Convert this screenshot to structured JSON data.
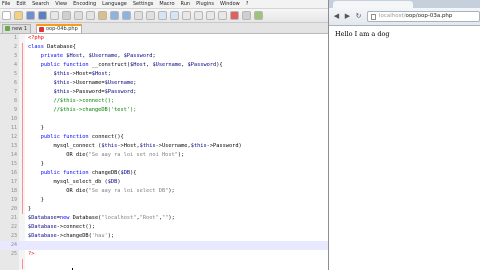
{
  "editor": {
    "menu": [
      "File",
      "Edit",
      "Search",
      "View",
      "Encoding",
      "Language",
      "Settings",
      "Macro",
      "Run",
      "Plugins",
      "Window",
      "?"
    ],
    "tabs": [
      "new 1",
      "oop-04b.php"
    ],
    "lines": [
      {
        "n": "1",
        "t": "<?php"
      },
      {
        "n": "2",
        "t": "class Database{"
      },
      {
        "n": "3",
        "t": "    private $Host, $Username, $Password;"
      },
      {
        "n": "4",
        "t": "    public function __construct($Host, $Username, $Password){"
      },
      {
        "n": "5",
        "t": "        $this->Host=$Host;"
      },
      {
        "n": "6",
        "t": "        $this->Username=$Username;"
      },
      {
        "n": "7",
        "t": "        $this->Password=$Password;"
      },
      {
        "n": "8",
        "t": "        //$this->connect();"
      },
      {
        "n": "9",
        "t": "        //$this->changeDB('test');"
      },
      {
        "n": "10",
        "t": ""
      },
      {
        "n": "11",
        "t": "    }"
      },
      {
        "n": "12",
        "t": "    public function connect(){"
      },
      {
        "n": "13",
        "t": "        mysql_connect ($this->Host,$this->Username,$this->Password)"
      },
      {
        "n": "14",
        "t": "            OR die(\"Se aay ra loi set noi Host\");"
      },
      {
        "n": "15",
        "t": "    }"
      },
      {
        "n": "16",
        "t": "    public function changeDB($DB){"
      },
      {
        "n": "17",
        "t": "        mysql_select_db ($DB)"
      },
      {
        "n": "18",
        "t": "            OR die(\"Se aay ra loi select DB\");"
      },
      {
        "n": "19",
        "t": "    }"
      },
      {
        "n": "20",
        "t": "}"
      },
      {
        "n": "21",
        "t": "$Database=new Database(\"localhost\",\"Root\",\"\");"
      },
      {
        "n": "22",
        "t": "$Database->connect();"
      },
      {
        "n": "23",
        "t": "$Database->changeDB('hau');"
      },
      {
        "n": "24",
        "t": ""
      },
      {
        "n": "25",
        "t": "?>"
      }
    ]
  },
  "browser": {
    "url_scheme": "localhost/",
    "url_path": "oop/oop-03a.php",
    "page_text": "Hello I am a dog"
  },
  "colors": {
    "keyword": "#0000ff",
    "comment": "#008000",
    "string": "#808080",
    "php_tag": "#ff0000",
    "current_line": "#e8e8ff"
  }
}
